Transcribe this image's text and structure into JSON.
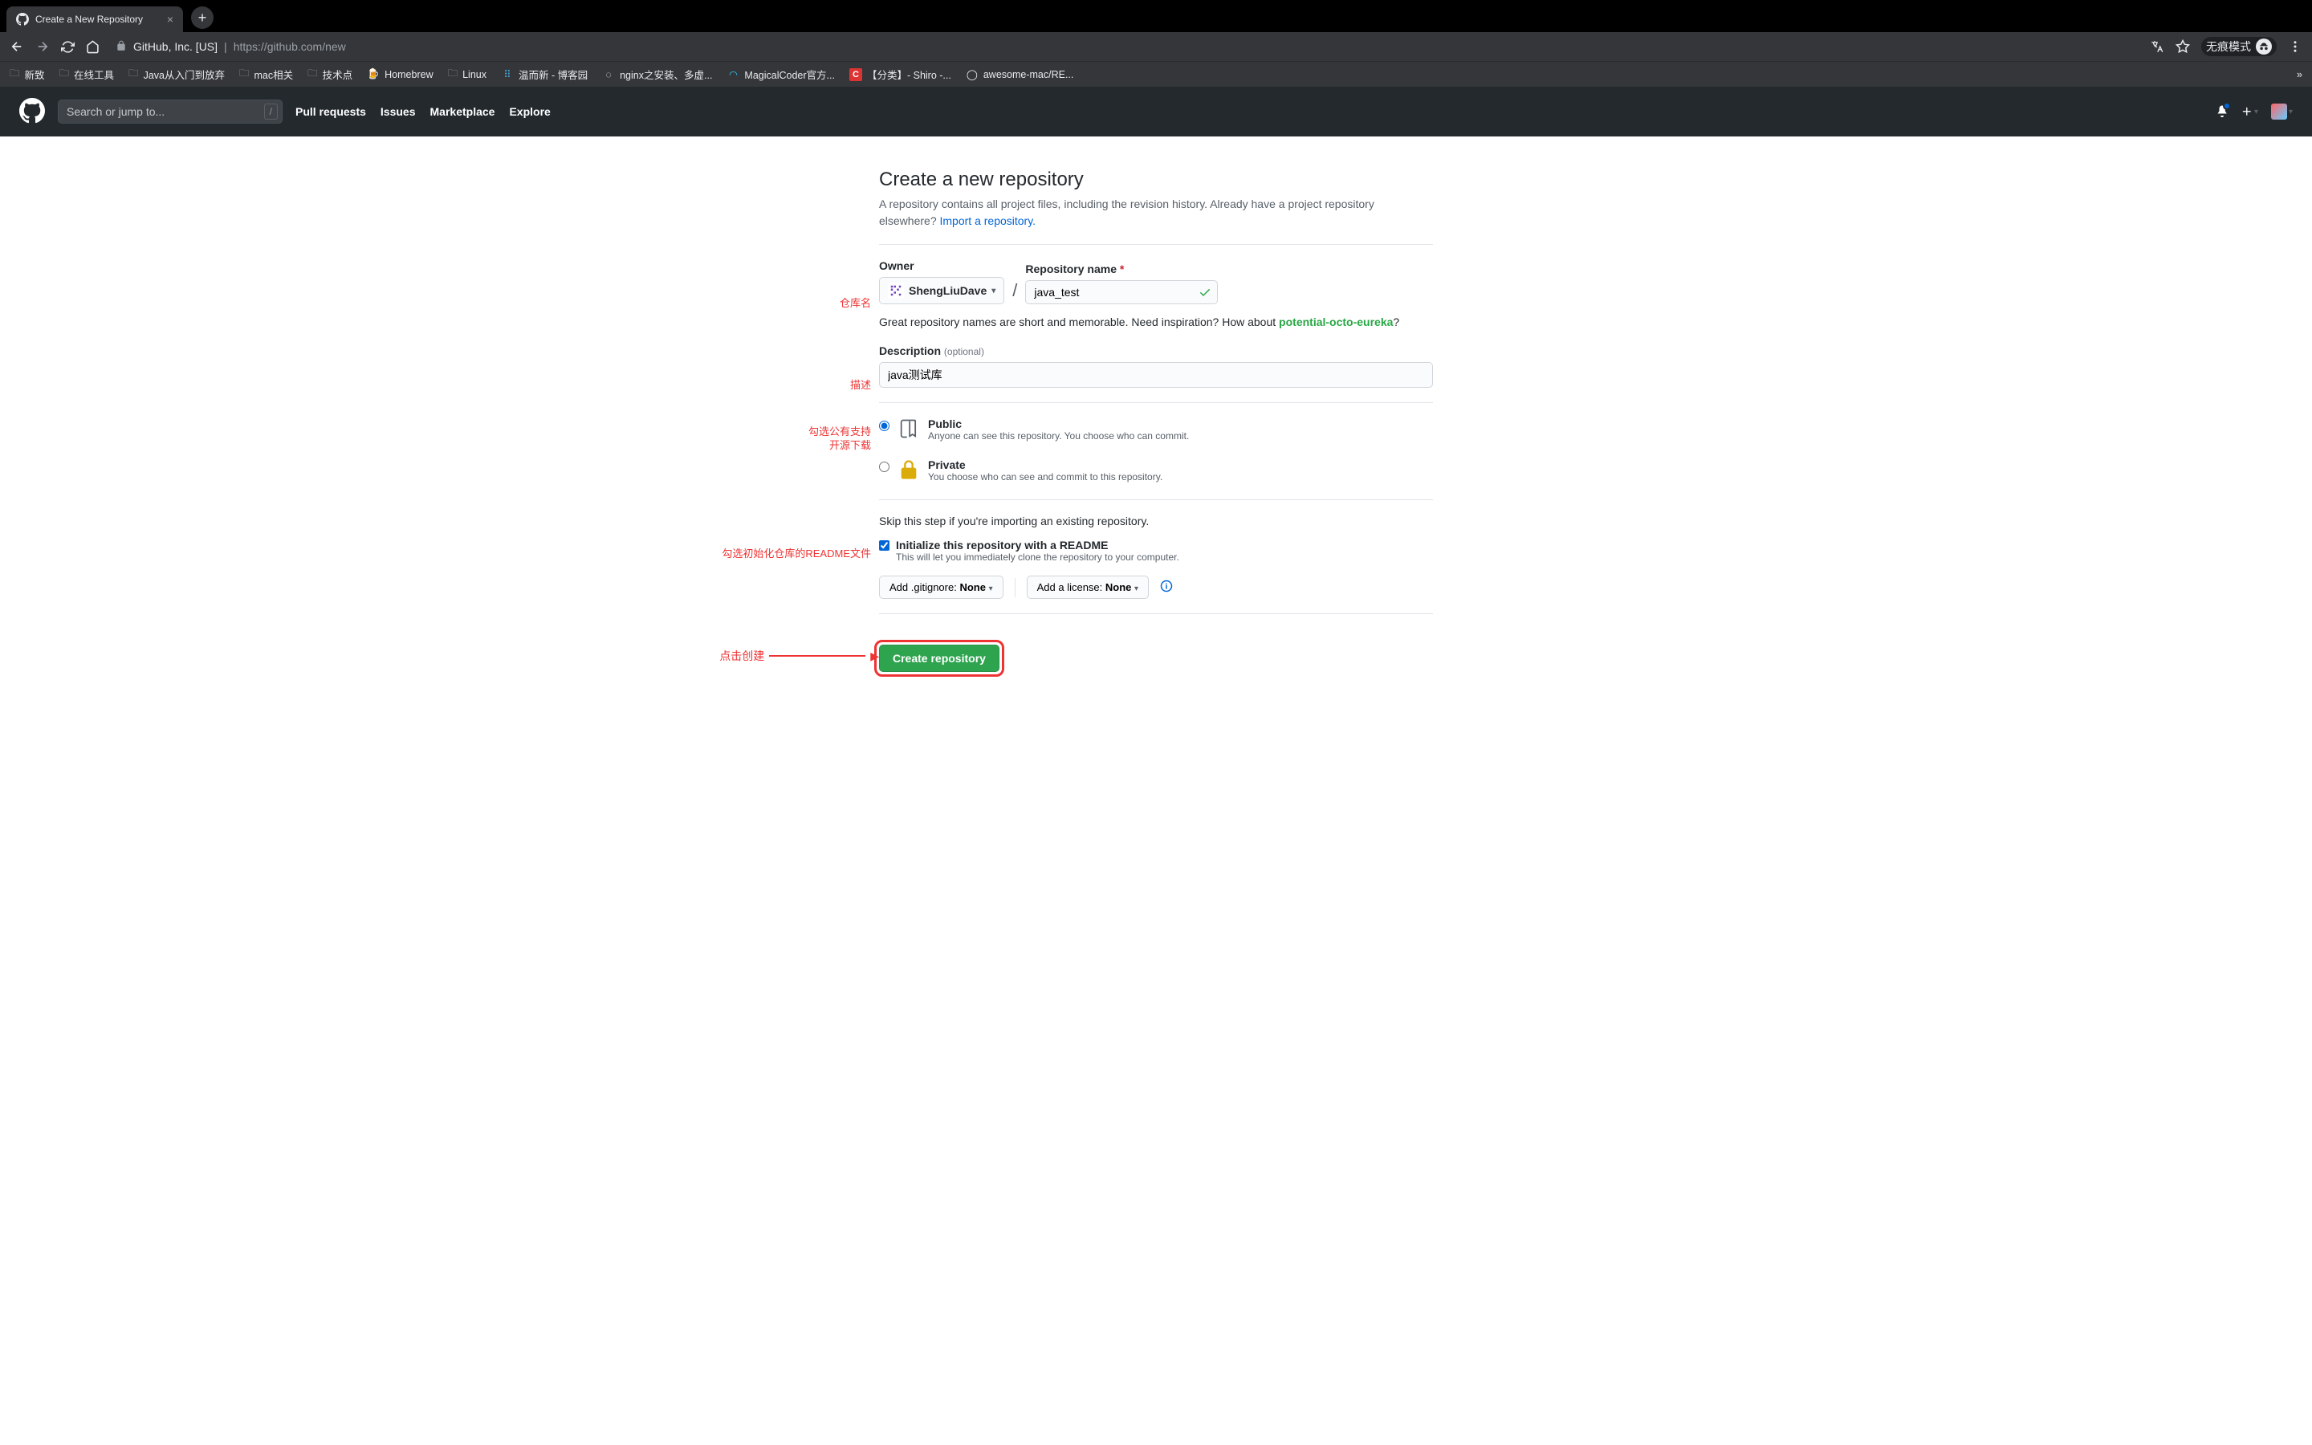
{
  "browser": {
    "tab_title": "Create a New Repository",
    "url_org": "GitHub, Inc. [US]",
    "url_path": "https://github.com/new",
    "incognito_label": "无痕模式",
    "bookmarks": [
      {
        "label": "新致",
        "type": "folder"
      },
      {
        "label": "在线工具",
        "type": "folder"
      },
      {
        "label": "Java从入门到放弃",
        "type": "folder"
      },
      {
        "label": "mac相关",
        "type": "folder"
      },
      {
        "label": "技术点",
        "type": "folder"
      },
      {
        "label": "Homebrew",
        "type": "link",
        "icon": "beer"
      },
      {
        "label": "Linux",
        "type": "folder"
      },
      {
        "label": "温而新 - 博客园",
        "type": "link",
        "icon": "dots"
      },
      {
        "label": "nginx之安装、多虚...",
        "type": "link",
        "icon": "blank"
      },
      {
        "label": "MagicalCoder官方...",
        "type": "link",
        "icon": "mc"
      },
      {
        "label": "【分类】- Shiro -...",
        "type": "link",
        "icon": "c"
      },
      {
        "label": "awesome-mac/RE...",
        "type": "link",
        "icon": "gh"
      }
    ]
  },
  "gh_header": {
    "search_placeholder": "Search or jump to...",
    "nav": [
      "Pull requests",
      "Issues",
      "Marketplace",
      "Explore"
    ]
  },
  "page": {
    "title": "Create a new repository",
    "subtitle_pre": "A repository contains all project files, including the revision history. Already have a project repository elsewhere? ",
    "subtitle_link": "Import a repository.",
    "owner_label": "Owner",
    "owner_value": "ShengLiuDave",
    "repo_label": "Repository name",
    "repo_value": "java_test",
    "hint_pre": "Great repository names are short and memorable. Need inspiration? How about ",
    "hint_suggest": "potential-octo-eureka",
    "hint_post": "?",
    "desc_label": "Description",
    "desc_optional": "(optional)",
    "desc_value": "java测试库",
    "vis_public_title": "Public",
    "vis_public_desc": "Anyone can see this repository. You choose who can commit.",
    "vis_private_title": "Private",
    "vis_private_desc": "You choose who can see and commit to this repository.",
    "skip_note": "Skip this step if you're importing an existing repository.",
    "init_title": "Initialize this repository with a README",
    "init_desc": "This will let you immediately clone the repository to your computer.",
    "gitignore_pre": "Add .gitignore: ",
    "gitignore_val": "None",
    "license_pre": "Add a license: ",
    "license_val": "None",
    "create_label": "Create repository"
  },
  "annotations": {
    "repo_name": "仓库名",
    "desc": "描述",
    "public": "勾选公有支持\n开源下载",
    "readme": "勾选初始化仓库的README文件",
    "create": "点击创建"
  }
}
